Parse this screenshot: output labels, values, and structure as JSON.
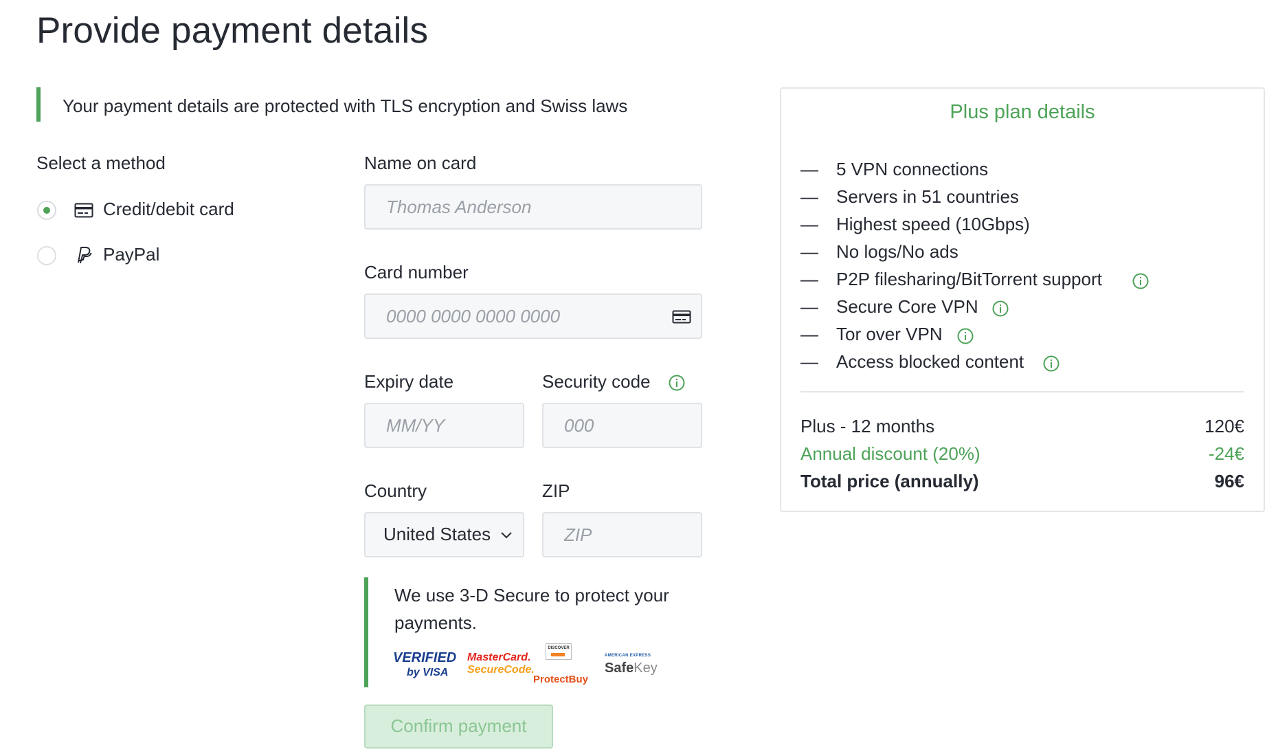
{
  "page": {
    "title": "Provide payment details",
    "security_notice": "Your payment details are protected with TLS encryption and Swiss laws"
  },
  "colors": {
    "accent": "#4da358",
    "text": "#262a33",
    "placeholder": "#9aa0a7",
    "input_bg": "#f6f7f8"
  },
  "method": {
    "label": "Select a method",
    "options": [
      {
        "label": "Credit/debit card",
        "icon": "credit-card-icon",
        "selected": true
      },
      {
        "label": "PayPal",
        "icon": "paypal-icon",
        "selected": false
      }
    ]
  },
  "form": {
    "name_label": "Name on card",
    "name_placeholder": "Thomas Anderson",
    "card_label": "Card number",
    "card_placeholder": "0000 0000 0000 0000",
    "expiry_label": "Expiry date",
    "expiry_placeholder": "MM/YY",
    "cvc_label": "Security code",
    "cvc_placeholder": "000",
    "country_label": "Country",
    "country_value": "United States",
    "zip_label": "ZIP",
    "zip_placeholder": "ZIP",
    "secure_text": "We use 3-D Secure to protect your payments.",
    "confirm_label": "Confirm payment"
  },
  "secure_logos": {
    "visa_top": "VERIFIED",
    "visa_bottom": "by VISA",
    "mc_top": "MasterCard.",
    "mc_bottom": "SecureCode.",
    "discover_badge": "DISCOVER",
    "discover_text": "ProtectBuy",
    "amex_top": "AMERICAN EXPRESS",
    "amex_safe": "Safe",
    "amex_key": "Key"
  },
  "plan": {
    "title": "Plus plan details",
    "dash": "—",
    "features": [
      {
        "text": "5 VPN connections",
        "info": false
      },
      {
        "text": "Servers in 51 countries",
        "info": false
      },
      {
        "text": "Highest speed (10Gbps)",
        "info": false
      },
      {
        "text": "No logs/No ads",
        "info": false
      },
      {
        "text": "P2P filesharing/BitTorrent support",
        "info": true
      },
      {
        "text": "Secure Core VPN",
        "info": true
      },
      {
        "text": "Tor over VPN",
        "info": true
      },
      {
        "text": "Access blocked content",
        "info": true
      }
    ],
    "line_item_label": "Plus - 12 months",
    "line_item_value": "120€",
    "discount_label": "Annual discount (20%)",
    "discount_value": "-24€",
    "total_label": "Total price (annually)",
    "total_value": "96€"
  }
}
